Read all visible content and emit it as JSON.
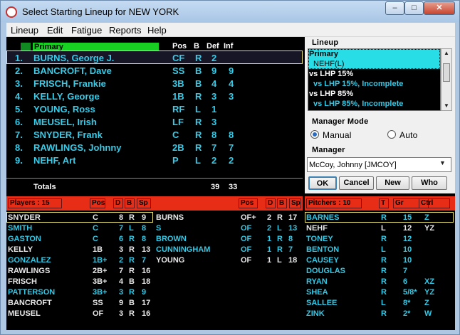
{
  "window": {
    "title": "Select Starting Lineup for NEW YORK",
    "min": "–",
    "max": "□",
    "close": "✕"
  },
  "menu": [
    "Lineup",
    "Edit",
    "Fatigue",
    "Reports",
    "Help"
  ],
  "lineup": {
    "header": {
      "name": "Primary",
      "pos": "Pos",
      "bats": "B",
      "def": "Def",
      "inf": "Inf"
    },
    "rows": [
      {
        "num": "1.",
        "name": "BURNS, George J.",
        "pos": "CF",
        "bats": "R",
        "def": "2",
        "inf": ""
      },
      {
        "num": "2.",
        "name": "BANCROFT, Dave",
        "pos": "SS",
        "bats": "B",
        "def": "9",
        "inf": "9"
      },
      {
        "num": "3.",
        "name": "FRISCH, Frankie",
        "pos": "3B",
        "bats": "B",
        "def": "4",
        "inf": "4"
      },
      {
        "num": "4.",
        "name": "KELLY, George",
        "pos": "1B",
        "bats": "R",
        "def": "3",
        "inf": "3"
      },
      {
        "num": "5.",
        "name": "YOUNG, Ross",
        "pos": "RF",
        "bats": "L",
        "def": "1",
        "inf": ""
      },
      {
        "num": "6.",
        "name": "MEUSEL, Irish",
        "pos": "LF",
        "bats": "R",
        "def": "3",
        "inf": ""
      },
      {
        "num": "7.",
        "name": "SNYDER, Frank",
        "pos": "C",
        "bats": "R",
        "def": "8",
        "inf": "8"
      },
      {
        "num": "8.",
        "name": "RAWLINGS, Johnny",
        "pos": "2B",
        "bats": "R",
        "def": "7",
        "inf": "7"
      },
      {
        "num": "9.",
        "name": "NEHF, Art",
        "pos": "P",
        "bats": "L",
        "def": "2",
        "inf": "2"
      }
    ],
    "totals": {
      "label": "Totals",
      "def": "39",
      "inf": "33"
    }
  },
  "side": {
    "lineup_label": "Lineup",
    "lineup_list": [
      {
        "text": "Primary",
        "selected": true
      },
      {
        "text": "NEHF(L)",
        "selected": true,
        "sub": true
      },
      {
        "text": "vs LHP 15%",
        "selected": false
      },
      {
        "text": "vs LHP 15%, Incomplete",
        "selected": false,
        "sub": true
      },
      {
        "text": "vs LHP 85%",
        "selected": false
      },
      {
        "text": "vs LHP 85%, Incomplete",
        "selected": false,
        "sub": true
      }
    ],
    "manager_mode_label": "Manager Mode",
    "manual_label": "Manual",
    "auto_label": "Auto",
    "manager_label": "Manager",
    "manager_value": "McCoy, Johnny [JMCOY]",
    "ok": "OK",
    "cancel": "Cancel",
    "new": "New",
    "who": "Who"
  },
  "players": {
    "header": {
      "title": "Players : 15",
      "pos": "Pos",
      "d": "D",
      "b": "B",
      "sp": "Sp"
    },
    "left": [
      {
        "name": "SNYDER",
        "pos": "C",
        "d": "8",
        "b": "R",
        "sp": "9",
        "color": "white"
      },
      {
        "name": "SMITH",
        "pos": "C",
        "d": "7",
        "b": "L",
        "sp": "8",
        "color": "cyan"
      },
      {
        "name": "GASTON",
        "pos": "C",
        "d": "6",
        "b": "R",
        "sp": "8",
        "color": "cyan"
      },
      {
        "name": "KELLY",
        "pos": "1B",
        "d": "3",
        "b": "R",
        "sp": "13",
        "color": "white"
      },
      {
        "name": "GONZALEZ",
        "pos": "1B+",
        "d": "2",
        "b": "R",
        "sp": "7",
        "color": "cyan"
      },
      {
        "name": "RAWLINGS",
        "pos": "2B+",
        "d": "7",
        "b": "R",
        "sp": "16",
        "color": "white"
      },
      {
        "name": "FRISCH",
        "pos": "3B+",
        "d": "4",
        "b": "B",
        "sp": "18",
        "color": "white"
      },
      {
        "name": "PATTERSON",
        "pos": "3B+",
        "d": "3",
        "b": "R",
        "sp": "9",
        "color": "cyan"
      },
      {
        "name": "BANCROFT",
        "pos": "SS",
        "d": "9",
        "b": "B",
        "sp": "17",
        "color": "white"
      },
      {
        "name": "MEUSEL",
        "pos": "OF",
        "d": "3",
        "b": "R",
        "sp": "16",
        "color": "white"
      }
    ],
    "right": [
      {
        "name": "BURNS",
        "pos": "OF+",
        "d": "2",
        "b": "R",
        "sp": "17",
        "color": "white"
      },
      {
        "name": "S",
        "pos": "OF",
        "d": "2",
        "b": "L",
        "sp": "13",
        "color": "cyan"
      },
      {
        "name": "BROWN",
        "pos": "OF",
        "d": "1",
        "b": "R",
        "sp": "8",
        "color": "cyan"
      },
      {
        "name": "CUNNINGHAM",
        "pos": "OF",
        "d": "1",
        "b": "R",
        "sp": "7",
        "color": "cyan"
      },
      {
        "name": "YOUNG",
        "pos": "OF",
        "d": "1",
        "b": "L",
        "sp": "18",
        "color": "white"
      }
    ]
  },
  "pitchers": {
    "header": {
      "title": "Pitchers : 10",
      "t": "T",
      "gr": "Gr",
      "ctrl": "Ctrl"
    },
    "rows": [
      {
        "name": "BARNES",
        "t": "R",
        "gr": "15",
        "ctrl": "Z",
        "color": "cyan"
      },
      {
        "name": "NEHF",
        "t": "L",
        "gr": "12",
        "ctrl": "YZ",
        "color": "white"
      },
      {
        "name": "TONEY",
        "t": "R",
        "gr": "12",
        "ctrl": "",
        "color": "cyan"
      },
      {
        "name": "BENTON",
        "t": "L",
        "gr": "10",
        "ctrl": "",
        "color": "cyan"
      },
      {
        "name": "CAUSEY",
        "t": "R",
        "gr": "10",
        "ctrl": "",
        "color": "cyan"
      },
      {
        "name": "DOUGLAS",
        "t": "R",
        "gr": "7",
        "ctrl": "",
        "color": "cyan"
      },
      {
        "name": "RYAN",
        "t": "R",
        "gr": "6",
        "ctrl": "XZ",
        "color": "cyan"
      },
      {
        "name": "SHEA",
        "t": "R",
        "gr": "5/8*",
        "ctrl": "YZ",
        "color": "cyan"
      },
      {
        "name": "SALLEE",
        "t": "L",
        "gr": "8*",
        "ctrl": "Z",
        "color": "cyan"
      },
      {
        "name": "ZINK",
        "t": "R",
        "gr": "2*",
        "ctrl": "W",
        "color": "cyan"
      }
    ]
  },
  "colors": {
    "cyan": "#33c9e6",
    "white": "#ffffff",
    "red": "#e82d17",
    "green": "#17d021",
    "list_selected": "#29dde6"
  }
}
